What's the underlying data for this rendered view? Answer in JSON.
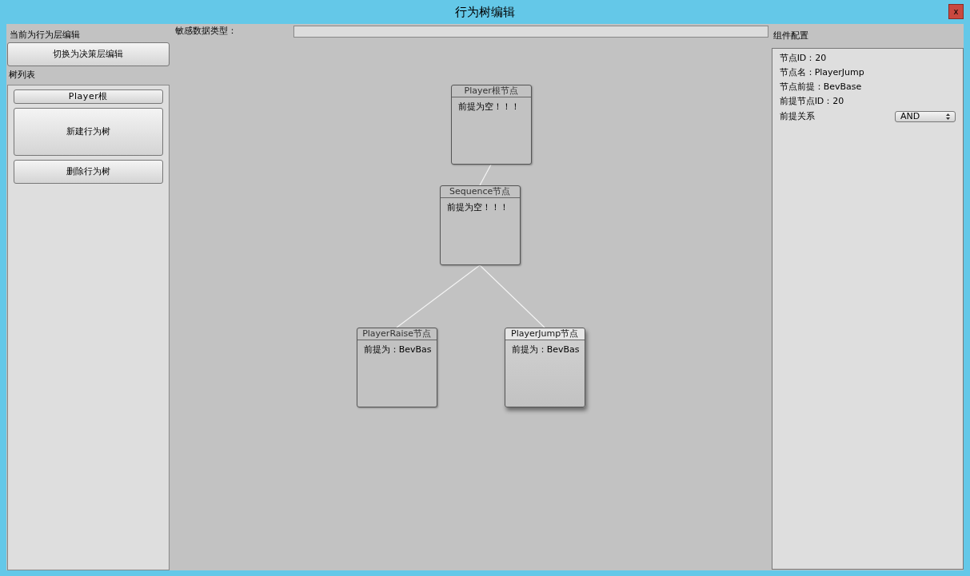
{
  "window": {
    "title": "行为树编辑",
    "close": "x"
  },
  "left_panel": {
    "mode_label": "当前为行为层编辑",
    "switch_button": "切换为决策层编辑",
    "tree_list_label": "树列表",
    "trees": [
      {
        "label": "Player根",
        "selected": false
      }
    ],
    "buttons": [
      "新建行为树",
      "删除行为树"
    ]
  },
  "canvas": {
    "field_label": "敏感数据类型：",
    "tree": {
      "title": "Player根节点",
      "body": "前提为空！！！",
      "selected": false,
      "children": [
        {
          "title": "Sequence节点",
          "body": "前提为空！！！",
          "selected": false,
          "children": [
            {
              "title": "PlayerRaise节点",
              "body": "前提为：BevBas",
              "selected": false
            },
            {
              "title": "PlayerJump节点",
              "body": "前提为：BevBas",
              "selected": true
            }
          ]
        }
      ]
    }
  },
  "right_panel": {
    "title": "组件配置",
    "fields": [
      "节点ID：20",
      "节点名：PlayerJump",
      "节点前提：BevBase",
      "前提节点ID：20"
    ],
    "relation": {
      "label": "前提关系",
      "value": "AND"
    }
  }
}
